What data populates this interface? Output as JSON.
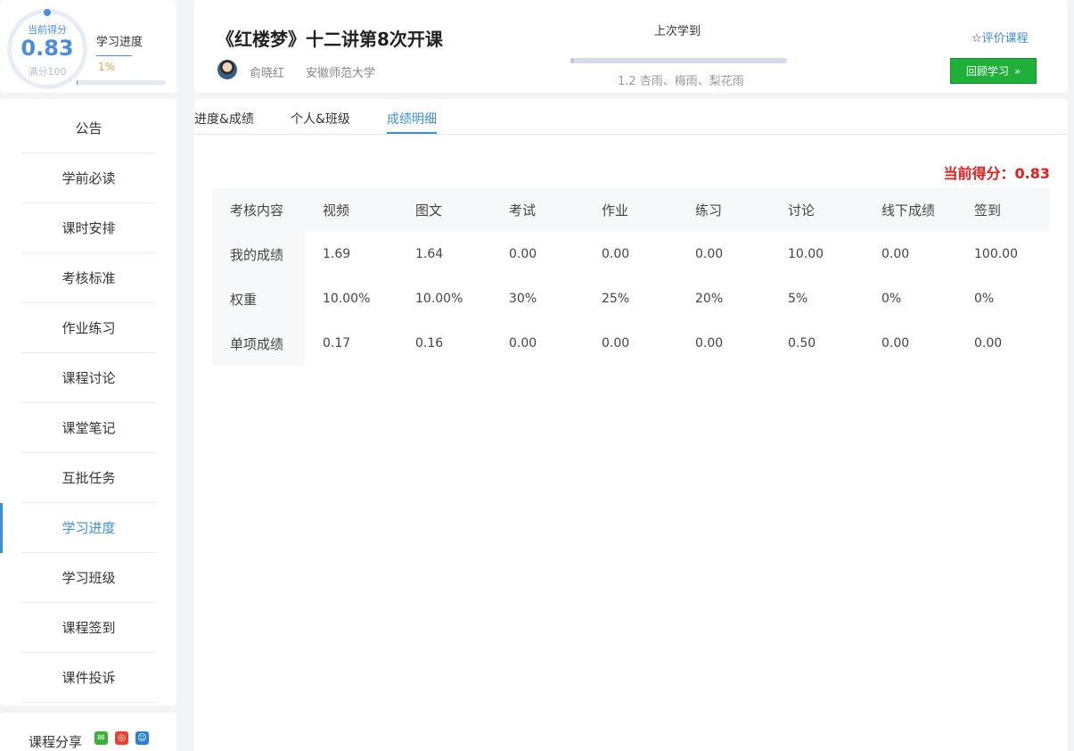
{
  "score": {
    "label": "当前得分",
    "value": "0.83",
    "full": "满分100"
  },
  "progress": {
    "title": "学习进度",
    "percent_text": "1%",
    "percent": 1
  },
  "sidebar": {
    "items": [
      {
        "label": "公告"
      },
      {
        "label": "学前必读"
      },
      {
        "label": "课时安排"
      },
      {
        "label": "考核标准"
      },
      {
        "label": "作业练习"
      },
      {
        "label": "课程讨论"
      },
      {
        "label": "课堂笔记"
      },
      {
        "label": "互批任务"
      },
      {
        "label": "学习进度"
      },
      {
        "label": "学习班级"
      },
      {
        "label": "课程签到"
      },
      {
        "label": "课件投诉"
      }
    ],
    "active_index": 8
  },
  "share": {
    "label": "课程分享",
    "icons": [
      "wechat-icon",
      "weibo-icon",
      "qq-icon"
    ]
  },
  "header": {
    "title": "《红楼梦》十二讲第8次开课",
    "teacher": "俞晓红",
    "school": "安徽师范大学",
    "last_title": "上次学到",
    "last_chapter": "1.2 杏雨、梅雨、梨花雨",
    "rate_label": "评价课程",
    "review_label": "回顾学习"
  },
  "tabs": [
    {
      "label": "进度&成绩"
    },
    {
      "label": "个人&班级"
    },
    {
      "label": "成绩明细"
    }
  ],
  "current_score": "当前得分：0.83",
  "table": {
    "headers": [
      "考核内容",
      "视频",
      "图文",
      "考试",
      "作业",
      "练习",
      "讨论",
      "线下成绩",
      "签到"
    ],
    "rows": [
      [
        "我的成绩",
        "1.69",
        "1.64",
        "0.00",
        "0.00",
        "0.00",
        "10.00",
        "0.00",
        "100.00"
      ],
      [
        "权重",
        "10.00%",
        "10.00%",
        "30%",
        "25%",
        "20%",
        "5%",
        "0%",
        "0%"
      ],
      [
        "单项成绩",
        "0.17",
        "0.16",
        "0.00",
        "0.00",
        "0.00",
        "0.50",
        "0.00",
        "0.00"
      ]
    ]
  },
  "colors": {
    "accent": "#3d8fd8",
    "score_red": "#e31b1b",
    "button_green": "#1fb03a",
    "progress_orange": "#f0a050"
  }
}
